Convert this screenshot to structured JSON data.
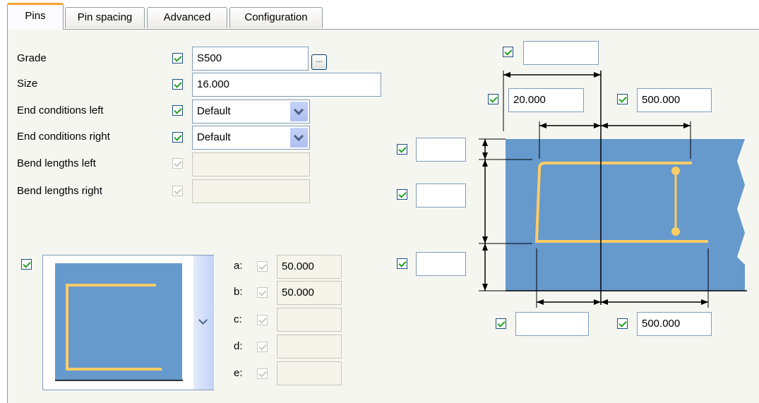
{
  "tabs": [
    {
      "label": "Pins",
      "active": true
    },
    {
      "label": "Pin spacing",
      "active": false
    },
    {
      "label": "Advanced",
      "active": false
    },
    {
      "label": "Configuration",
      "active": false
    }
  ],
  "fields": {
    "grade": {
      "label": "Grade",
      "value": "S500",
      "button": "..."
    },
    "size": {
      "label": "Size",
      "value": "16.000"
    },
    "end_left": {
      "label": "End conditions left",
      "value": "Default"
    },
    "end_right": {
      "label": "End conditions right",
      "value": "Default"
    },
    "bend_left": {
      "label": "Bend lengths left",
      "value": ""
    },
    "bend_right": {
      "label": "Bend lengths right",
      "value": ""
    }
  },
  "dims": {
    "a": {
      "label": "a:",
      "value": "50.000"
    },
    "b": {
      "label": "b:",
      "value": "50.000"
    },
    "c": {
      "label": "c:",
      "value": ""
    },
    "d": {
      "label": "d:",
      "value": ""
    },
    "e": {
      "label": "e:",
      "value": ""
    }
  },
  "diagram": {
    "top_field": "",
    "left_offset": "20.000",
    "right_offset": "500.000",
    "side1": "",
    "side2": "",
    "side3": "",
    "bottom_left": "",
    "bottom_right": "500.000"
  },
  "colors": {
    "concrete": "#6699cc",
    "rebar": "#ffcc66",
    "accent": "#f4a02b"
  }
}
